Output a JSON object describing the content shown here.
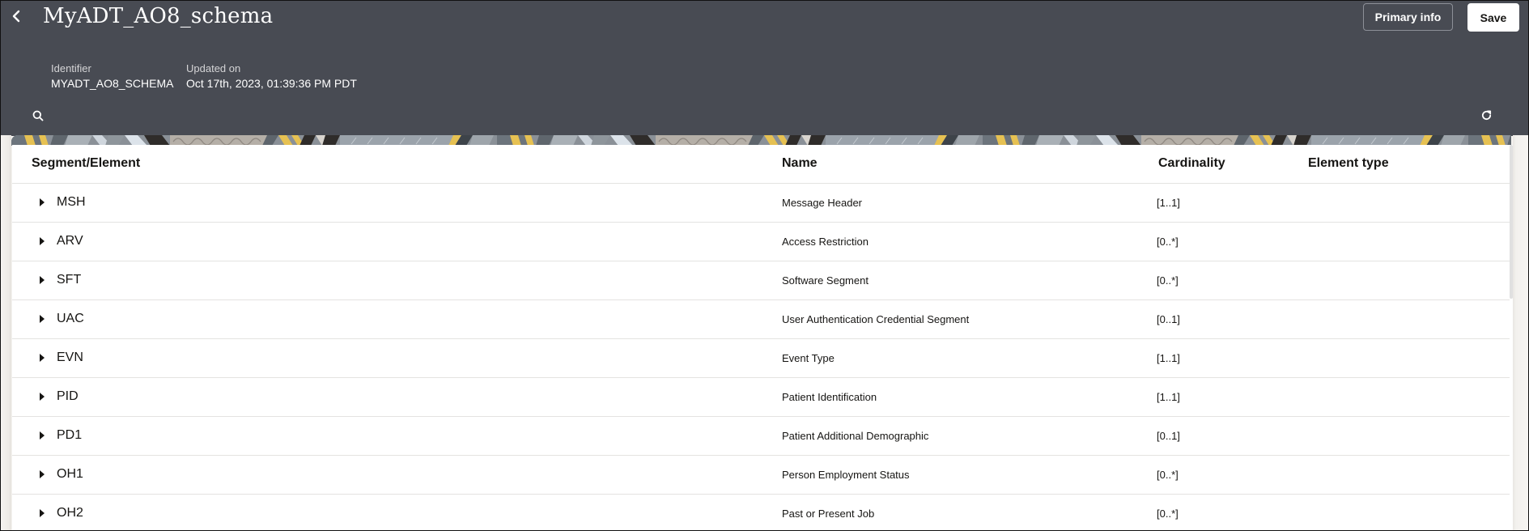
{
  "header": {
    "title": "MyADT_AO8_schema",
    "back_icon": "chevron-left-icon",
    "primary_info_label": "Primary info",
    "save_label": "Save",
    "identifier_label": "Identifier",
    "identifier_value": "MYADT_AO8_SCHEMA",
    "updated_label": "Updated on",
    "updated_value": "Oct 17th, 2023, 01:39:36 PM PDT",
    "search_icon": "search-icon",
    "refresh_icon": "refresh-icon"
  },
  "colors": {
    "header_bg": "#484b53",
    "banner_yellow": "#e9c14f",
    "text_primary": "#161513"
  },
  "table": {
    "columns": [
      "Segment/Element",
      "Name",
      "Cardinality",
      "Element type"
    ],
    "rows": [
      {
        "segment": "MSH",
        "name": "Message Header",
        "cardinality": "[1..1]",
        "element_type": ""
      },
      {
        "segment": "ARV",
        "name": "Access Restriction",
        "cardinality": "[0..*]",
        "element_type": ""
      },
      {
        "segment": "SFT",
        "name": "Software Segment",
        "cardinality": "[0..*]",
        "element_type": ""
      },
      {
        "segment": "UAC",
        "name": "User Authentication Credential Segment",
        "cardinality": "[0..1]",
        "element_type": ""
      },
      {
        "segment": "EVN",
        "name": "Event Type",
        "cardinality": "[1..1]",
        "element_type": ""
      },
      {
        "segment": "PID",
        "name": "Patient Identification",
        "cardinality": "[1..1]",
        "element_type": ""
      },
      {
        "segment": "PD1",
        "name": "Patient Additional Demographic",
        "cardinality": "[0..1]",
        "element_type": ""
      },
      {
        "segment": "OH1",
        "name": "Person Employment Status",
        "cardinality": "[0..*]",
        "element_type": ""
      },
      {
        "segment": "OH2",
        "name": "Past or Present Job",
        "cardinality": "[0..*]",
        "element_type": ""
      }
    ]
  }
}
